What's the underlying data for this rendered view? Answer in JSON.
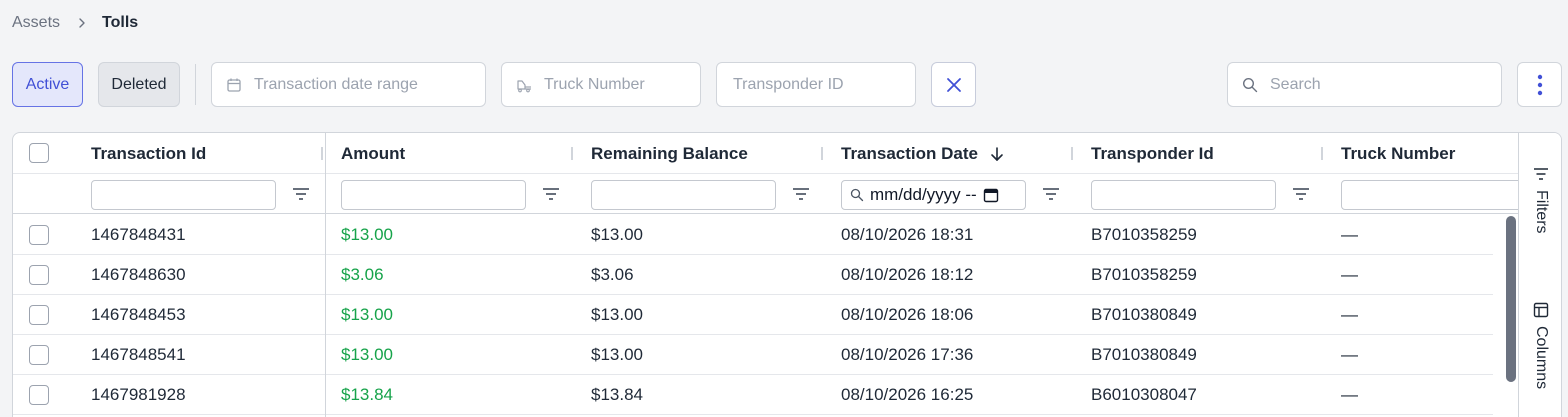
{
  "breadcrumb": {
    "parent": "Assets",
    "current": "Tolls"
  },
  "toolbar": {
    "active_label": "Active",
    "deleted_label": "Deleted",
    "date_range_placeholder": "Transaction date range",
    "truck_placeholder": "Truck Number",
    "transponder_placeholder": "Transponder ID",
    "search_placeholder": "Search"
  },
  "colors": {
    "accent": "#4150d6",
    "amount": "#16a34a"
  },
  "table": {
    "columns": [
      "Transaction Id",
      "Amount",
      "Remaining Balance",
      "Transaction Date",
      "Transponder Id",
      "Truck Number"
    ],
    "date_filter_value": "mm/dd/yyyy --",
    "rows": [
      {
        "id": "1467848431",
        "amount": "$13.00",
        "balance": "$13.00",
        "date": "08/10/2026 18:31",
        "transponder": "B7010358259",
        "truck": "—"
      },
      {
        "id": "1467848630",
        "amount": "$3.06",
        "balance": "$3.06",
        "date": "08/10/2026 18:12",
        "transponder": "B7010358259",
        "truck": "—"
      },
      {
        "id": "1467848453",
        "amount": "$13.00",
        "balance": "$13.00",
        "date": "08/10/2026 18:06",
        "transponder": "B7010380849",
        "truck": "—"
      },
      {
        "id": "1467848541",
        "amount": "$13.00",
        "balance": "$13.00",
        "date": "08/10/2026 17:36",
        "transponder": "B7010380849",
        "truck": "—"
      },
      {
        "id": "1467981928",
        "amount": "$13.84",
        "balance": "$13.84",
        "date": "08/10/2026 16:25",
        "transponder": "B6010308047",
        "truck": "—"
      }
    ]
  },
  "side_panel": {
    "filters_label": "Filters",
    "columns_label": "Columns"
  },
  "icons": {
    "breadcrumb_sep": "chevron-right-icon",
    "date": "calendar-icon",
    "truck": "truck-icon",
    "clear": "close-icon",
    "search": "search-icon",
    "more": "more-vertical-icon",
    "filter": "filter-icon",
    "sort": "arrow-down-icon",
    "filters_tab": "filter-lines-icon",
    "columns_tab": "columns-icon"
  }
}
